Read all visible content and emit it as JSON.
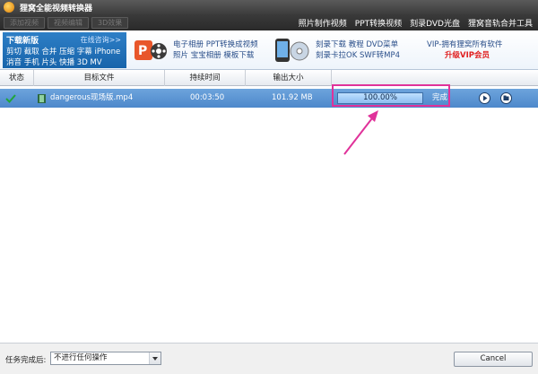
{
  "window": {
    "title": "狸窝全能视频转换器"
  },
  "toolbar": {
    "buttons": [
      "添加视频",
      "视频编辑",
      "3D效果"
    ],
    "links": [
      "照片制作视频",
      "PPT转换视频",
      "刻录DVD光盘",
      "狸窝音轨合并工具"
    ]
  },
  "banner": {
    "promo": {
      "head": "下载新版",
      "online": "在线咨询>>",
      "line1": "剪切 截取 合并 压缩 字幕 iPhone",
      "line2": "消音 手机 片头 快播 3D MV"
    },
    "item1": {
      "line1": "电子相册 PPT转换成视频",
      "line2": "照片 宝宝相册 模板下载"
    },
    "item2": {
      "line1": "刻录下载 教程 DVD菜单",
      "line2": "刻录卡拉OK SWF转MP4"
    },
    "vip": {
      "line1": "VIP-拥有狸窝所有软件",
      "line2": "升级VIP会员"
    }
  },
  "table": {
    "headers": [
      "状态",
      "目标文件",
      "持续时间",
      "输出大小",
      ""
    ],
    "rows": [
      {
        "status_icon": "checkmark-icon",
        "file": "dangerous现场版.mp4",
        "duration": "00:03:50",
        "size": "101.92 MB",
        "progress_text": "100.00%",
        "progress": 1.0,
        "status": "完成"
      }
    ]
  },
  "footer": {
    "label": "任务完成后:",
    "select_value": "不进行任何操作",
    "cancel": "Cancel"
  },
  "colors": {
    "row_selected": "#5b93d3",
    "highlight": "#e0329a",
    "vip_red": "#e02020"
  }
}
